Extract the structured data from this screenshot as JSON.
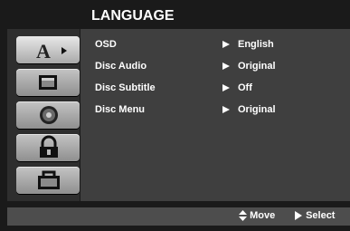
{
  "menu": {
    "title": "LANGUAGE"
  },
  "sidebar": {
    "tabs": [
      {
        "icon": "language-icon",
        "active": true
      },
      {
        "icon": "display-icon",
        "active": false
      },
      {
        "icon": "audio-icon",
        "active": false
      },
      {
        "icon": "lock-icon",
        "active": false
      },
      {
        "icon": "others-icon",
        "active": false
      }
    ]
  },
  "settings": [
    {
      "label": "OSD",
      "value": "English"
    },
    {
      "label": "Disc Audio",
      "value": "Original"
    },
    {
      "label": "Disc Subtitle",
      "value": "Off"
    },
    {
      "label": "Disc Menu",
      "value": "Original"
    }
  ],
  "footer": {
    "move_label": "Move",
    "select_label": "Select"
  },
  "colors": {
    "background": "#1a1a1a",
    "panel": "#3f3f3f",
    "sidebar": "#2e2e2e",
    "footer": "#4d4d4d",
    "text": "#ffffff"
  }
}
